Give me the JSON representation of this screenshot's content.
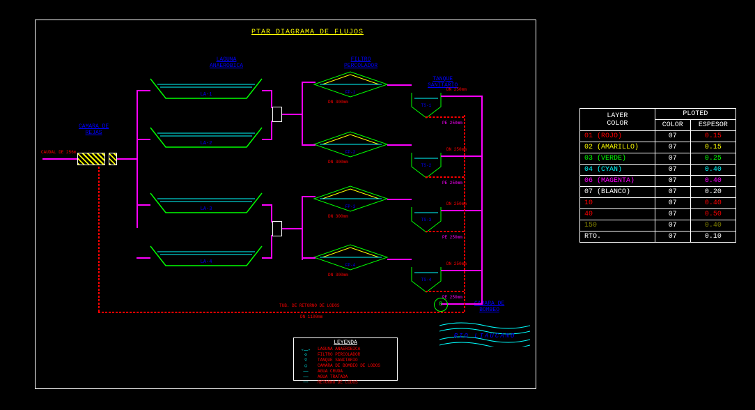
{
  "title": "PTAR  DIAGRAMA  DE  FLUJOS",
  "labels": {
    "camara_rejas": "CAMARA DE\nREJAS",
    "laguna": "LAGUNA\nANAEROBICA",
    "filtro": "FILTRO\nPERCOLADOR",
    "tanque": "TANQUE\nSANITARIO",
    "camara_bombeo": "CAMARA DE\nBOMBEO",
    "rio": "RIO  LIAUCANO",
    "caudal": "CAUDAL DE 256m",
    "tub_retorno": "TUB. DE RETORNO DE LODOS",
    "dn_1100": "DN 1100mm",
    "dn_300": "DN 300mm",
    "dn_250": "DN 250mm",
    "pe_250": "PE 250mm"
  },
  "units": {
    "la": [
      "LA-1",
      "LA-2",
      "LA-3",
      "LA-4"
    ],
    "fp": [
      "FP-1",
      "FP-2",
      "FP-3",
      "FP-4"
    ],
    "ts": [
      "TS-1",
      "TS-2",
      "TS-3",
      "TS-4"
    ]
  },
  "legend": {
    "title": "LEYENDA",
    "rows": [
      {
        "sym": "⌄⎽⌄",
        "text": "LAGUNA ANAEROBICA"
      },
      {
        "sym": "◇",
        "text": "FILTRO PERCOLADOR"
      },
      {
        "sym": "▽",
        "text": "TANQUE SANITARIO"
      },
      {
        "sym": "◯",
        "text": "CAMARA DE BOMBEO DE LODOS"
      },
      {
        "sym": "──",
        "text": "AGUA CRUDA"
      },
      {
        "sym": "──",
        "text": "AGUA TRATADA"
      },
      {
        "sym": "╌╌",
        "text": "RETORNO DE LODOS"
      }
    ]
  },
  "bomba": "B",
  "layer_table": {
    "head": [
      "LAYER",
      "PLOTED"
    ],
    "sub": [
      "COLOR",
      "COLOR",
      "ESPESOR"
    ],
    "rows": [
      {
        "layer": "01 (ROJO)",
        "col": "07",
        "esp": "0.15",
        "cls": "c-red",
        "ecls": "c-red"
      },
      {
        "layer": "02 (AMARILLO)",
        "col": "07",
        "esp": "0.15",
        "cls": "c-yel",
        "ecls": "c-yel"
      },
      {
        "layer": "03 (VERDE)",
        "col": "07",
        "esp": "0.25",
        "cls": "c-grn",
        "ecls": "c-grn"
      },
      {
        "layer": "04 (CYAN)",
        "col": "07",
        "esp": "0.40",
        "cls": "c-cyn",
        "ecls": "c-cyn"
      },
      {
        "layer": "06 (MAGENTA)",
        "col": "07",
        "esp": "0.40",
        "cls": "c-mag",
        "ecls": "c-mag"
      },
      {
        "layer": "07 (BLANCO)",
        "col": "07",
        "esp": "0.20",
        "cls": "c-wht",
        "ecls": "c-wht"
      },
      {
        "layer": "10",
        "col": "07",
        "esp": "0.40",
        "cls": "c-red",
        "ecls": "c-red"
      },
      {
        "layer": "40",
        "col": "07",
        "esp": "0.50",
        "cls": "c-red",
        "ecls": "c-red"
      },
      {
        "layer": "150",
        "col": "07",
        "esp": "0.40",
        "cls": "c-dg",
        "ecls": "c-dg"
      },
      {
        "layer": "RTO.",
        "col": "07",
        "esp": "0.10",
        "cls": "c-wht",
        "ecls": "c-wht"
      }
    ]
  }
}
